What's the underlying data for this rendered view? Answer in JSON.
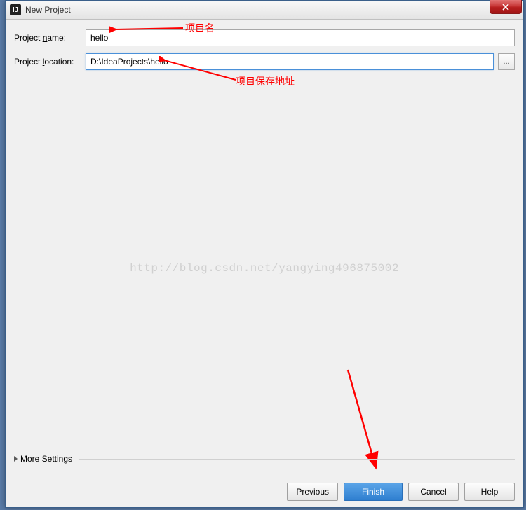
{
  "window": {
    "title": "New Project",
    "icon_text": "IJ"
  },
  "form": {
    "project_name_label": "Project name:",
    "project_name_value": "hello",
    "project_location_label": "Project location:",
    "project_location_value": "D:\\IdeaProjects\\hello",
    "browse_label": "..."
  },
  "annotations": {
    "name_note": "项目名",
    "location_note": "项目保存地址"
  },
  "watermark": "http://blog.csdn.net/yangying496875002",
  "more_settings_label": "More Settings",
  "buttons": {
    "previous": "Previous",
    "finish": "Finish",
    "cancel": "Cancel",
    "help": "Help"
  }
}
